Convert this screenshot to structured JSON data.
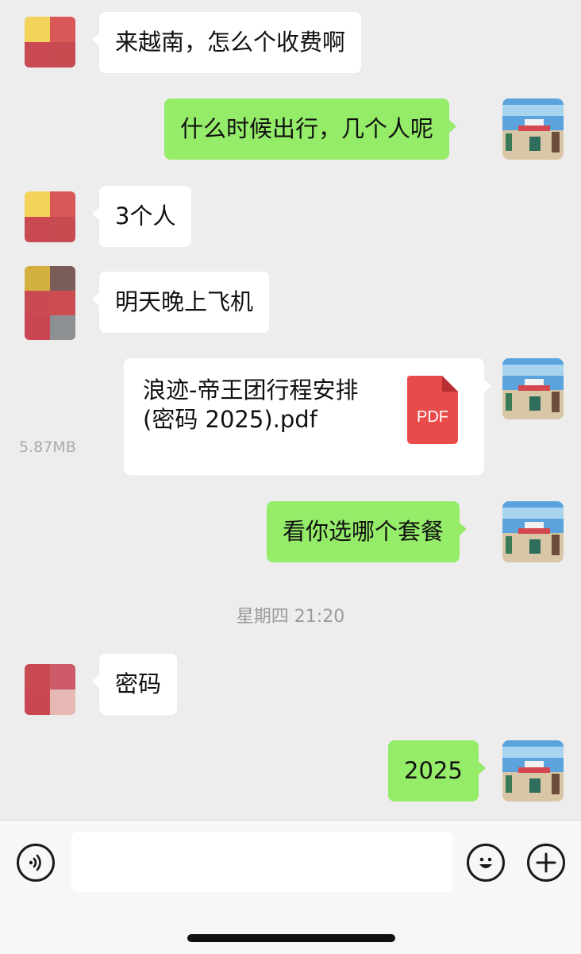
{
  "messages": [
    {
      "side": "in",
      "text": "来越南，怎么个收费啊"
    },
    {
      "side": "out",
      "text": "什么时候出行，几个人呢"
    },
    {
      "side": "in",
      "text": "3个人"
    },
    {
      "side": "in",
      "text": "明天晚上飞机"
    },
    {
      "side": "out",
      "type": "file",
      "file_name": "浪迹-帝王团行程安排 (密码 2025).pdf",
      "file_size": "5.87MB",
      "file_icon_label": "PDF"
    },
    {
      "side": "out",
      "text": "看你选哪个套餐"
    },
    {
      "side": "in",
      "text": "密码"
    },
    {
      "side": "out",
      "text": "2025"
    }
  ],
  "timestamp": "星期四 21:20",
  "input_bar": {
    "voice_icon": "voice-icon",
    "emoji_icon": "emoji-icon",
    "plus_icon": "plus-icon",
    "input_value": ""
  },
  "colors": {
    "background": "#ededed",
    "outgoing_bubble": "#95ec69",
    "incoming_bubble": "#ffffff",
    "pdf_red": "#e94b4b"
  }
}
